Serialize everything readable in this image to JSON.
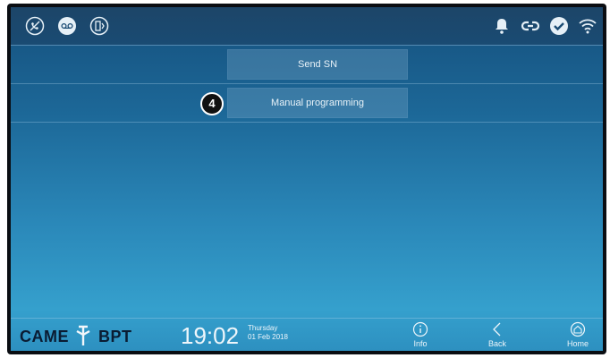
{
  "status_bar": {
    "left_icons": [
      "no-phone-icon",
      "voicemail-icon",
      "door-icon"
    ],
    "right_icons": [
      "bell-icon",
      "link-icon",
      "check-icon",
      "wifi-icon"
    ]
  },
  "menu": {
    "items": [
      {
        "label": "Send SN",
        "badge": ""
      },
      {
        "label": "Manual programming",
        "badge": "4"
      }
    ]
  },
  "footer": {
    "brand_left": "CAME",
    "brand_right": "BPT",
    "time": "19:02",
    "day": "Thursday",
    "date": "01 Feb 2018",
    "nav": {
      "info": "Info",
      "back": "Back",
      "home": "Home"
    }
  },
  "colors": {
    "screen_top": "#16507d",
    "screen_bottom": "#35a0cd",
    "brand": "#0a1c33",
    "text": "#eef6fb"
  }
}
